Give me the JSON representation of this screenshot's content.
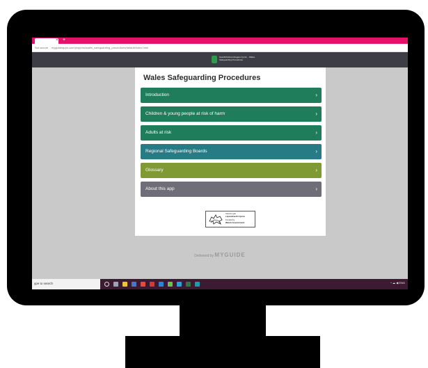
{
  "browser": {
    "tab_close": "×",
    "new_tab": "+",
    "security": "Not secure",
    "url": "myguideapps.com/projects/wales_safeguarding_procedures/default/index.html"
  },
  "header": {
    "logo_text": "Gweithdrefnau Diogelu Cymru · Wales Safeguarding Procedures"
  },
  "page": {
    "title": "Wales Safeguarding Procedures",
    "menu": [
      {
        "label": "Introduction",
        "color": "#1f7d5c"
      },
      {
        "label": "Children & young people at risk of harm",
        "color": "#1f7d5c"
      },
      {
        "label": "Adults at risk",
        "color": "#1f7d5c"
      },
      {
        "label": "Regional Safeguarding Boards",
        "color": "#267b85"
      },
      {
        "label": "Glossary",
        "color": "#7f9a33"
      },
      {
        "label": "About this app",
        "color": "#6e6d78"
      }
    ],
    "chevron": "›"
  },
  "funding": {
    "line1": "Ariennir gan",
    "line2": "Llywodraeth Cymru",
    "line3": "Funded by",
    "line4": "Welsh Government"
  },
  "footer": {
    "delivered_by": "Delivered by",
    "brand": "MYGUIDE"
  },
  "taskbar": {
    "search_placeholder": "ype to search",
    "tray": "^ ☁ ◀ ENG"
  }
}
